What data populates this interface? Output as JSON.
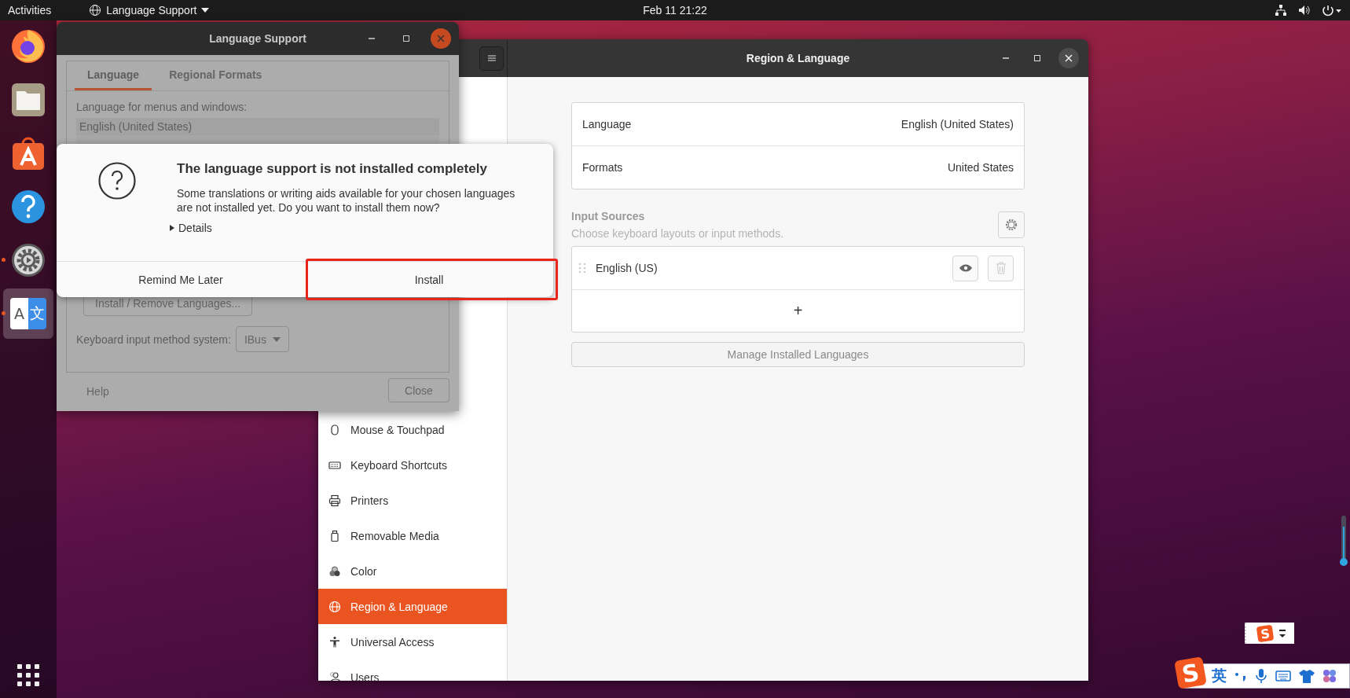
{
  "top_bar": {
    "activities": "Activities",
    "app_menu": "Language Support",
    "clock": "Feb 11  21:22"
  },
  "dock": {
    "items": [
      {
        "kind": "firefox",
        "running": false,
        "active": false
      },
      {
        "kind": "files",
        "running": false,
        "active": false
      },
      {
        "kind": "software",
        "running": false,
        "active": false
      },
      {
        "kind": "help",
        "running": false,
        "active": false
      },
      {
        "kind": "settings",
        "running": true,
        "active": false
      },
      {
        "kind": "language",
        "running": true,
        "active": true,
        "glyphs": [
          "A",
          "文"
        ]
      }
    ]
  },
  "settings_window": {
    "title": "Region & Language",
    "sidebar": [
      {
        "kind": "mouse",
        "label": "Mouse & Touchpad",
        "selected": false
      },
      {
        "kind": "keyboard",
        "label": "Keyboard Shortcuts",
        "selected": false
      },
      {
        "kind": "printer",
        "label": "Printers",
        "selected": false
      },
      {
        "kind": "media",
        "label": "Removable Media",
        "selected": false
      },
      {
        "kind": "color",
        "label": "Color",
        "selected": false
      },
      {
        "kind": "globe",
        "label": "Region & Language",
        "selected": true
      },
      {
        "kind": "access",
        "label": "Universal Access",
        "selected": false
      },
      {
        "kind": "users",
        "label": "Users",
        "selected": false
      }
    ],
    "rows": [
      {
        "label": "Language",
        "value": "English (United States)"
      },
      {
        "label": "Formats",
        "value": "United States"
      }
    ],
    "input_sources": {
      "title": "Input Sources",
      "subtitle": "Choose keyboard layouts or input methods.",
      "items": [
        {
          "name": "English (US)"
        }
      ],
      "add": "+"
    },
    "manage_button": "Manage Installed Languages"
  },
  "language_support_window": {
    "title": "Language Support",
    "tabs": [
      {
        "label": "Language",
        "selected": true
      },
      {
        "label": "Regional Formats",
        "selected": false
      }
    ],
    "menu_label": "Language for menus and windows:",
    "languages": [
      "English (United States)"
    ],
    "install_remove_button": "Install / Remove Languages...",
    "input_method_label": "Keyboard input method system:",
    "input_method": "IBus",
    "help_button": "Help",
    "close_button": "Close"
  },
  "dialog": {
    "title": "The language support is not installed completely",
    "message": "Some translations or writing aids available for your chosen languages are not installed yet. Do you want to install them now?",
    "details": {
      "label": "Details",
      "expanded": false
    },
    "buttons": [
      {
        "label": "Remind Me Later",
        "highlighted": false
      },
      {
        "label": "Install",
        "highlighted": true
      }
    ]
  },
  "ime": {
    "status_logo": "S",
    "logo": "S",
    "mode": "英"
  }
}
